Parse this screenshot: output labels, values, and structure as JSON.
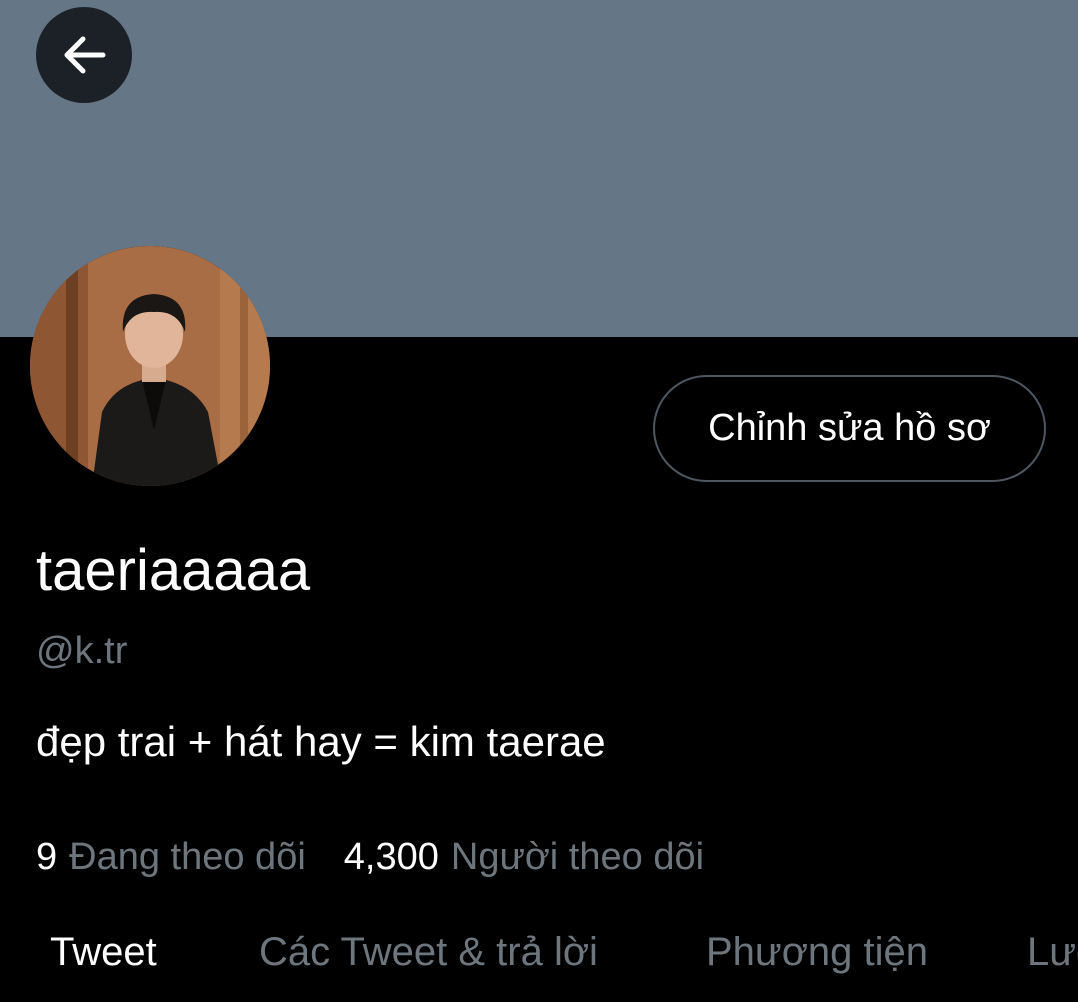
{
  "header": {
    "back_icon": "arrow-left-icon",
    "banner_color": "#657786"
  },
  "profile": {
    "edit_button_label": "Chỉnh sửa hồ sơ",
    "display_name": "taeriaaaaa",
    "handle": "@k.tr",
    "bio": "đẹp trai + hát hay = kim taerae",
    "following_count": "9",
    "following_label": "Đang theo dõi",
    "followers_count": "4,300",
    "followers_label": "Người theo dõi"
  },
  "tabs": [
    {
      "label": "Tweet",
      "active": true
    },
    {
      "label": "Các Tweet & trả lời",
      "active": false
    },
    {
      "label": "Phương tiện",
      "active": false
    },
    {
      "label": "Lượt thích",
      "active": false
    }
  ],
  "colors": {
    "background": "#000000",
    "text_primary": "#ffffff",
    "text_secondary": "#6e767d",
    "button_border": "#4d5761"
  }
}
